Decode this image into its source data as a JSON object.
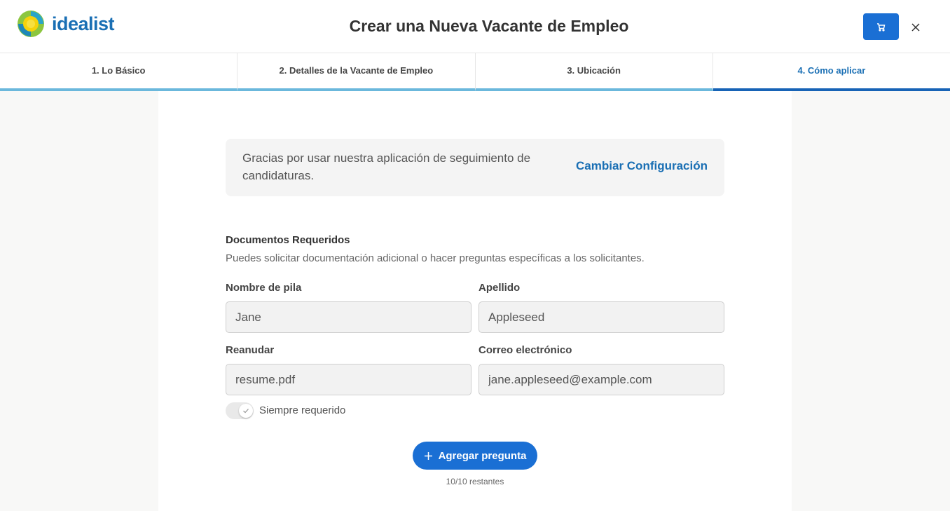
{
  "brand": {
    "name": "idealist",
    "accent": "#1a6fd4",
    "logo_color": "#1a6fb4"
  },
  "header": {
    "title": "Crear una Nueva Vacante de Empleo",
    "cart_icon": "cart-icon",
    "close_icon": "close-icon"
  },
  "steps": [
    {
      "label": "1. Lo Básico",
      "active": false
    },
    {
      "label": "2. Detalles de la Vacante de Empleo",
      "active": false
    },
    {
      "label": "3. Ubicación",
      "active": false
    },
    {
      "label": "4. Cómo aplicar",
      "active": true
    }
  ],
  "ats": {
    "message": "Gracias por usar nuestra aplicación de seguimiento de candidaturas.",
    "link": "Cambiar Configuración"
  },
  "documents": {
    "title": "Documentos Requeridos",
    "description": "Puedes solicitar documentación adicional o hacer preguntas específicas a los solicitantes.",
    "fields": {
      "first_name": {
        "label": "Nombre de pila",
        "value": "Jane"
      },
      "last_name": {
        "label": "Apellido",
        "value": "Appleseed"
      },
      "resume": {
        "label": "Reanudar",
        "value": "resume.pdf"
      },
      "email": {
        "label": "Correo electrónico",
        "value": "jane.appleseed@example.com"
      }
    },
    "always_required": {
      "label": "Siempre requerido",
      "checked": true
    }
  },
  "add_question": {
    "label": "Agregar pregunta",
    "remaining": "10/10 restantes"
  }
}
